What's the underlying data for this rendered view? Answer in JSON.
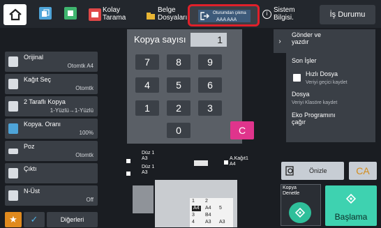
{
  "topbar": {
    "tab1_label": "Kolay\nTarama",
    "tab2_label": "Belge\nDosyaları",
    "logout_label": "Oturumdan çıkma",
    "logout_user": "AAA AAA",
    "system_label": "Sistem\nBilgisi.",
    "job_status_label": "İş Durumu"
  },
  "left_menu": [
    {
      "title": "Orijinal",
      "value": "Otomtk A4"
    },
    {
      "title": "Kağıt Seç",
      "value": "Otomtk"
    },
    {
      "title": "2 Taraflı Kopya",
      "value": "1-Yüzlü→1-Yüzlü"
    },
    {
      "title": "Kopya. Oranı",
      "value": "100%"
    },
    {
      "title": "Poz",
      "value": "Otomtk"
    },
    {
      "title": "Çıktı",
      "value": ""
    },
    {
      "title": "N-Üst",
      "value": "Off"
    }
  ],
  "bottom_left": {
    "other_label": "Diğerleri"
  },
  "keypad": {
    "copy_label": "Kopya sayısı",
    "copy_count": "1",
    "keys": [
      "7",
      "8",
      "9",
      "4",
      "5",
      "6",
      "1",
      "2",
      "3",
      "0",
      "C"
    ]
  },
  "right_panel": {
    "send_print": "Gönder ve\nyazdır",
    "recent_jobs": "Son İşler",
    "quick_file": "Hızlı Dosya",
    "quick_file_sub": "Veriyi geçici kaydet",
    "file": "Dosya",
    "file_sub": "Veriyi Klasöre kaydet",
    "eco_program": "Eko Programını\nçağır"
  },
  "actions": {
    "preview": "Önizle",
    "ca": "CA",
    "proof_copy": "Kopya\nDenetle",
    "start": "Başlama"
  },
  "diagram": {
    "tray1_label": "Düz 1\nA3",
    "tray2_label": "Düz 1\nA3",
    "paper_label": "A.Kağıt1\nA4",
    "grid": [
      [
        "1",
        "",
        "2",
        ""
      ],
      [
        "A4",
        "A4",
        "5",
        ""
      ],
      [
        "3",
        "B4",
        "",
        ""
      ],
      [
        "4",
        "A3",
        "",
        "A3"
      ]
    ]
  },
  "colors": {
    "accent_orange": "#e08a1e",
    "clear_key": "#e0348c",
    "start_button": "#3ed2b0",
    "highlight_border": "#e0202a"
  }
}
